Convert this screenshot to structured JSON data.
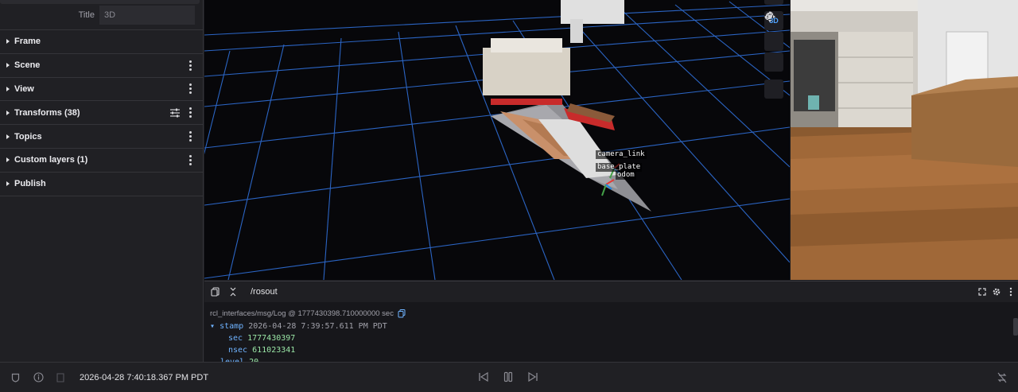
{
  "sidebar": {
    "title_label": "Title",
    "title_value": "3D",
    "sections": [
      {
        "label": "Frame"
      },
      {
        "label": "Scene"
      },
      {
        "label": "View"
      },
      {
        "label": "Transforms (38)"
      },
      {
        "label": "Topics"
      },
      {
        "label": "Custom layers (1)"
      },
      {
        "label": "Publish"
      }
    ]
  },
  "view3d": {
    "toolbar_3d_label": "3D",
    "tf_labels": [
      "camera_link",
      "base_plate",
      "odom"
    ],
    "grid_color": "#2f6fd8"
  },
  "message_panel": {
    "topic": "/rosout",
    "schema": "rcl_interfaces/msg/Log @ 1777430398.710000000 sec",
    "stamp_key": "stamp",
    "stamp_value": "2026-04-28 7:39:57.611 PM PDT",
    "sec_key": "sec",
    "sec_value": "1777430397",
    "nsec_key": "nsec",
    "nsec_value": "611023341",
    "level_key": "level",
    "level_value": "20"
  },
  "playbar": {
    "current_time": "2026-04-28 7:40:18.367 PM PDT"
  }
}
